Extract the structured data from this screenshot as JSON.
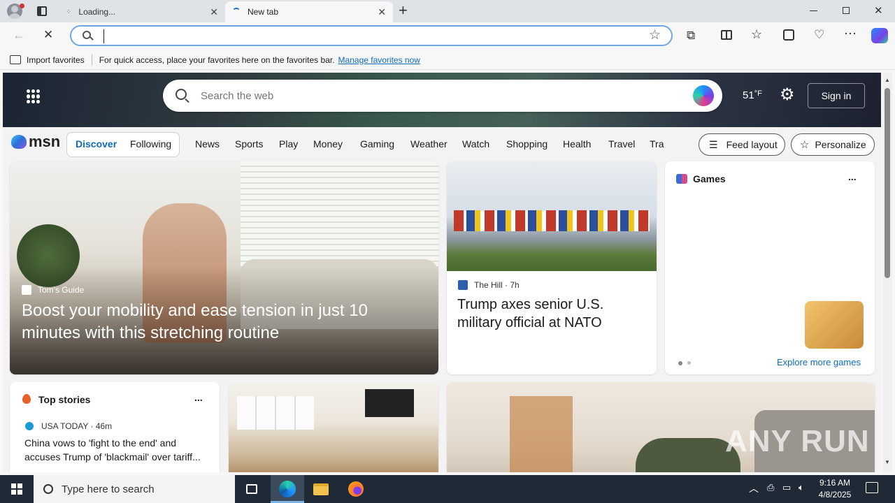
{
  "browser": {
    "tabs": [
      {
        "label": "Loading...",
        "icon": "loading-dots-icon"
      },
      {
        "label": "New tab",
        "icon": "edge-spinner-icon"
      }
    ],
    "address_value": "",
    "favorites_bar": {
      "import_label": "Import favorites",
      "message": "For quick access, place your favorites here on the favorites bar.",
      "link": "Manage favorites now"
    }
  },
  "msn": {
    "search_placeholder": "Search the web",
    "temperature": "51",
    "temp_unit": "°F",
    "signin": "Sign in",
    "logo": "msn",
    "pills": [
      "Discover",
      "Following"
    ],
    "nav": [
      "News",
      "Sports",
      "Play",
      "Money",
      "Gaming",
      "Weather",
      "Watch",
      "Shopping",
      "Health",
      "Travel",
      "Tra"
    ],
    "feed_layout": "Feed layout",
    "personalize": "Personalize",
    "hero_article": {
      "source": "Tom's Guide",
      "title": "Boost your mobility and ease tension in just 10 minutes with this stretching routine"
    },
    "nato_article": {
      "source": "The Hill",
      "time": "7h",
      "title": "Trump axes senior U.S. military official at NATO"
    },
    "games": {
      "title": "Games",
      "more": "...",
      "explore": "Explore more games"
    },
    "top_stories": {
      "title": "Top stories",
      "more": "...",
      "source": "USA TODAY",
      "time": "46m",
      "headline": "China vows to 'fight to the end' and accuses Trump of 'blackmail' over tariff..."
    },
    "watermark": "ANY RUN"
  },
  "taskbar": {
    "search_placeholder": "Type here to search",
    "time": "9:16 AM",
    "date": "4/8/2025"
  },
  "colors": {
    "accent": "#0f6cbd",
    "taskbar": "#1f2a36"
  }
}
